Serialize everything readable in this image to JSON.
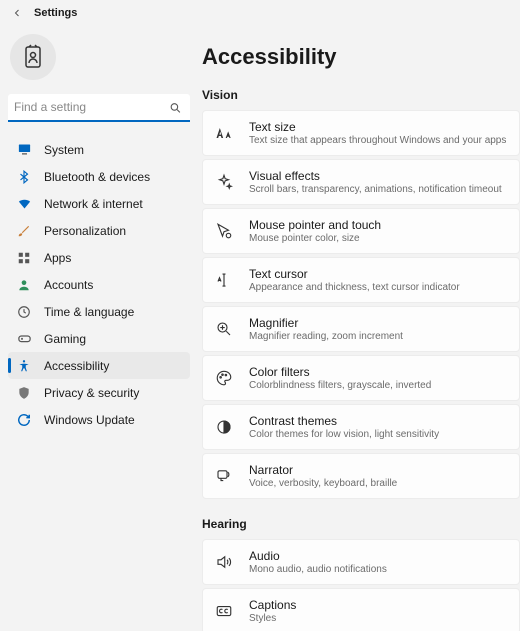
{
  "header": {
    "title": "Settings"
  },
  "search": {
    "placeholder": "Find a setting"
  },
  "nav": {
    "items": [
      {
        "label": "System"
      },
      {
        "label": "Bluetooth & devices"
      },
      {
        "label": "Network & internet"
      },
      {
        "label": "Personalization"
      },
      {
        "label": "Apps"
      },
      {
        "label": "Accounts"
      },
      {
        "label": "Time & language"
      },
      {
        "label": "Gaming"
      },
      {
        "label": "Accessibility"
      },
      {
        "label": "Privacy & security"
      },
      {
        "label": "Windows Update"
      }
    ]
  },
  "page": {
    "title": "Accessibility"
  },
  "sections": {
    "vision": {
      "header": "Vision",
      "items": [
        {
          "title": "Text size",
          "sub": "Text size that appears throughout Windows and your apps"
        },
        {
          "title": "Visual effects",
          "sub": "Scroll bars, transparency, animations, notification timeout"
        },
        {
          "title": "Mouse pointer and touch",
          "sub": "Mouse pointer color, size"
        },
        {
          "title": "Text cursor",
          "sub": "Appearance and thickness, text cursor indicator"
        },
        {
          "title": "Magnifier",
          "sub": "Magnifier reading, zoom increment"
        },
        {
          "title": "Color filters",
          "sub": "Colorblindness filters, grayscale, inverted"
        },
        {
          "title": "Contrast themes",
          "sub": "Color themes for low vision, light sensitivity"
        },
        {
          "title": "Narrator",
          "sub": "Voice, verbosity, keyboard, braille"
        }
      ]
    },
    "hearing": {
      "header": "Hearing",
      "items": [
        {
          "title": "Audio",
          "sub": "Mono audio, audio notifications"
        },
        {
          "title": "Captions",
          "sub": "Styles"
        }
      ]
    }
  }
}
